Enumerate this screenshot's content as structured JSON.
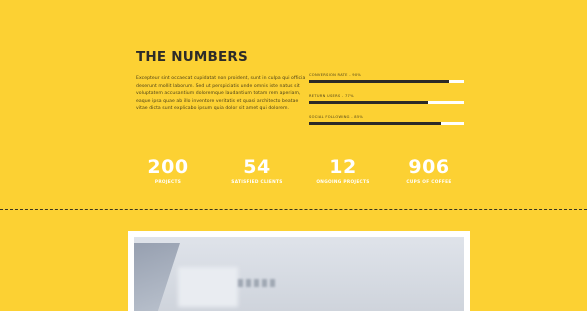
{
  "section": {
    "title": "THE NUMBERS",
    "paragraph": "Excepteur sint occaecat cupidatat non proident, sunt in culpa qui officia deserunt mollit laborum. Sed ut perspiciatis unde omnis iste natus sit voluptatem accusantium doloremque laudantium totam rem aperiam, eaque ipsa quae ab illo inventore veritatis et quasi architecto beatae vitae dicta sunt explicabo ipsum quia dolor sit amet qui dolorem."
  },
  "progress": [
    {
      "label": "CONVERSION RATE - 90%",
      "percent": 90
    },
    {
      "label": "RETURN USERS - 77%",
      "percent": 77
    },
    {
      "label": "SOCIAL FOLLOWING - 85%",
      "percent": 85
    }
  ],
  "stats": [
    {
      "value": "200",
      "label": "PROJECTS"
    },
    {
      "value": "54",
      "label": "SATISFIED CLIENTS"
    },
    {
      "value": "12",
      "label": "ONGOING PROJECTS"
    },
    {
      "value": "906",
      "label": "CUPS OF COFFEE"
    }
  ],
  "colors": {
    "background": "#fcd133",
    "progress_fill": "#2b2a27",
    "progress_track": "#ffffff",
    "stat_text": "#ffffff"
  }
}
